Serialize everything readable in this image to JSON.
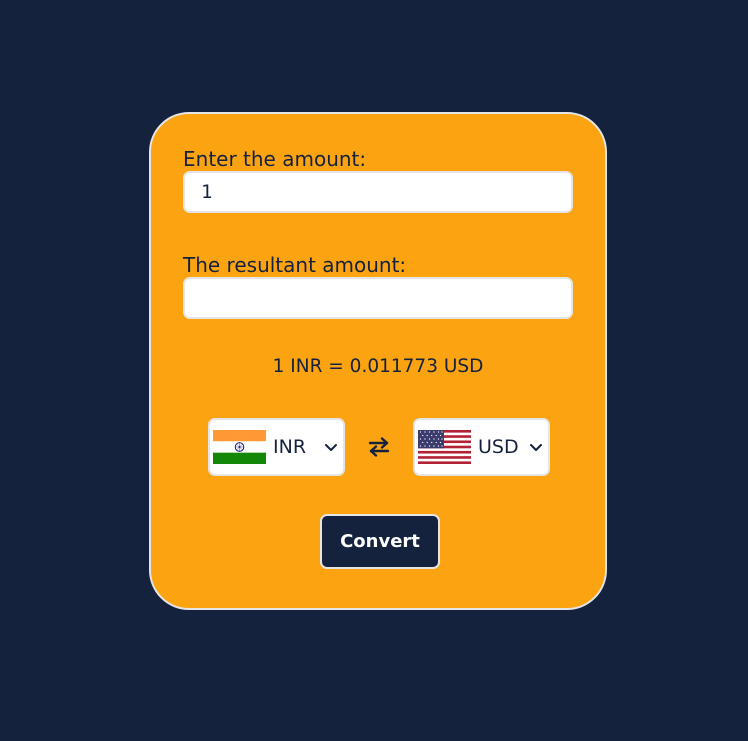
{
  "form": {
    "amount_label": "Enter the amount:",
    "amount_value": "1",
    "result_label": "The resultant amount:",
    "result_value": "",
    "rate_text": "1 INR = 0.011773 USD",
    "from_currency": {
      "code": "INR",
      "flag_icon": "india-flag-icon"
    },
    "to_currency": {
      "code": "USD",
      "flag_icon": "usa-flag-icon"
    },
    "swap_icon": "swap-arrows-icon",
    "convert_label": "Convert"
  },
  "colors": {
    "background": "#15223e",
    "card": "#fca311",
    "border": "#e5e5e5",
    "button": "#15223e",
    "text": "#15223e"
  }
}
